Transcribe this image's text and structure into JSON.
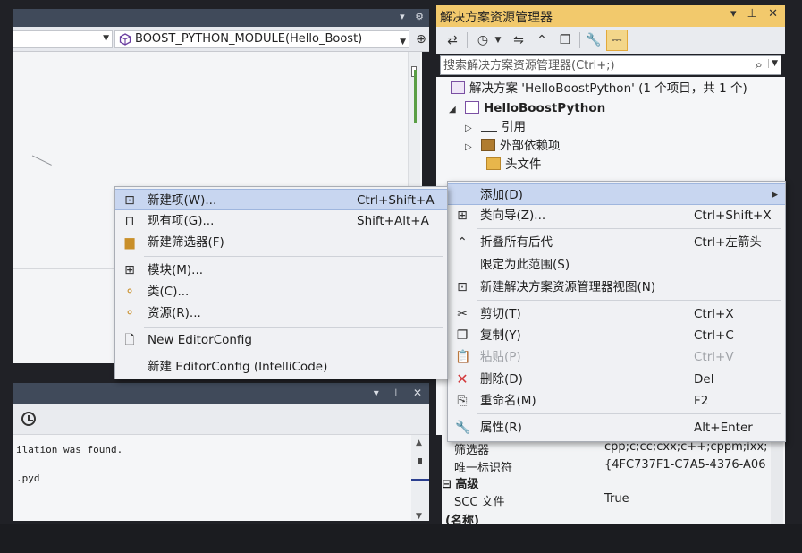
{
  "editor": {
    "nav": {
      "scope_value": "",
      "member_value": "BOOST_PYTHON_MODULE(Hello_Boost)",
      "split_glyph": "⊕"
    },
    "header_glyphs": [
      "▾",
      "⚙"
    ]
  },
  "output": {
    "header_glyphs": [
      "▾",
      "⊥",
      "✕"
    ],
    "lines": [
      "ilation was found.",
      ".pyd"
    ]
  },
  "solution_explorer": {
    "title": "解决方案资源管理器",
    "title_glyphs": [
      "▾",
      "⊥",
      "✕"
    ],
    "search_placeholder": "搜索解决方案资源管理器(Ctrl+;)",
    "tree": [
      {
        "label": "解决方案 'HelloBoostPython' (1 个项目，共 1 个)",
        "icon": "solution-icon"
      },
      {
        "label": "HelloBoostPython",
        "icon": "cpp-project-icon",
        "expander": "◢"
      },
      {
        "label": "引用",
        "icon": "references-icon",
        "expander": "▷"
      },
      {
        "label": "外部依赖项",
        "icon": "external-deps-icon",
        "expander": "▷"
      },
      {
        "label": "头文件",
        "icon": "filter-folder-icon"
      }
    ]
  },
  "properties": {
    "rows": [
      {
        "name": "筛选器",
        "value": "cpp;c;cc;cxx;c++;cppm;ixx;de"
      },
      {
        "name": "唯一标识符",
        "value": "{4FC737F1-C7A5-4376-A06"
      }
    ],
    "category": "高级",
    "category_rows": [
      {
        "name": "SCC 文件",
        "value": "True"
      }
    ],
    "footer": "(名称)"
  },
  "add_submenu": {
    "items": [
      {
        "label": "新建项(W)...",
        "shortcut": "Ctrl+Shift+A",
        "icon": "new-item-icon",
        "highlighted": true
      },
      {
        "label": "现有项(G)...",
        "shortcut": "Shift+Alt+A",
        "icon": "existing-item-icon"
      },
      {
        "label": "新建筛选器(F)",
        "shortcut": "",
        "icon": "new-filter-icon"
      },
      {
        "label": "模块(M)...",
        "shortcut": "",
        "icon": "module-icon"
      },
      {
        "label": "类(C)...",
        "shortcut": "",
        "icon": "class-icon"
      },
      {
        "label": "资源(R)...",
        "shortcut": "",
        "icon": "resource-icon"
      },
      {
        "label": "New EditorConfig",
        "shortcut": "",
        "icon": "editorconfig-icon"
      },
      {
        "label": "新建 EditorConfig (IntelliCode)",
        "shortcut": "",
        "icon": ""
      }
    ]
  },
  "context_menu": {
    "items": [
      {
        "label": "添加(D)",
        "shortcut": "",
        "icon": "",
        "highlighted": true,
        "submenu": true
      },
      {
        "label": "类向导(Z)...",
        "shortcut": "Ctrl+Shift+X",
        "icon": "class-wizard-icon"
      },
      {
        "label": "折叠所有后代",
        "shortcut": "Ctrl+左箭头",
        "icon": "collapse-icon"
      },
      {
        "label": "限定为此范围(S)",
        "shortcut": "",
        "icon": ""
      },
      {
        "label": "新建解决方案资源管理器视图(N)",
        "shortcut": "",
        "icon": "new-view-icon"
      },
      {
        "label": "剪切(T)",
        "shortcut": "Ctrl+X",
        "icon": "cut-icon"
      },
      {
        "label": "复制(Y)",
        "shortcut": "Ctrl+C",
        "icon": "copy-icon"
      },
      {
        "label": "粘贴(P)",
        "shortcut": "Ctrl+V",
        "icon": "paste-icon",
        "disabled": true
      },
      {
        "label": "删除(D)",
        "shortcut": "Del",
        "icon": "delete-icon"
      },
      {
        "label": "重命名(M)",
        "shortcut": "F2",
        "icon": "rename-icon"
      },
      {
        "label": "属性(R)",
        "shortcut": "Alt+Enter",
        "icon": "properties-wrench-icon"
      }
    ]
  },
  "colors": {
    "title_bar_active": "#f2c96c",
    "menu_highlight": "#c8d6f0",
    "delete_icon": "#d3393b"
  }
}
